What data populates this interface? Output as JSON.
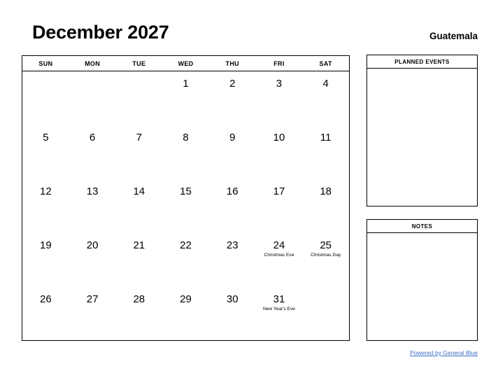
{
  "header": {
    "month_title": "December 2027",
    "country": "Guatemala"
  },
  "calendar": {
    "weekday_headers": [
      "SUN",
      "MON",
      "TUE",
      "WED",
      "THU",
      "FRI",
      "SAT"
    ],
    "weeks": [
      [
        {
          "day": "",
          "event": ""
        },
        {
          "day": "",
          "event": ""
        },
        {
          "day": "",
          "event": ""
        },
        {
          "day": "1",
          "event": ""
        },
        {
          "day": "2",
          "event": ""
        },
        {
          "day": "3",
          "event": ""
        },
        {
          "day": "4",
          "event": ""
        }
      ],
      [
        {
          "day": "5",
          "event": ""
        },
        {
          "day": "6",
          "event": ""
        },
        {
          "day": "7",
          "event": ""
        },
        {
          "day": "8",
          "event": ""
        },
        {
          "day": "9",
          "event": ""
        },
        {
          "day": "10",
          "event": ""
        },
        {
          "day": "11",
          "event": ""
        }
      ],
      [
        {
          "day": "12",
          "event": ""
        },
        {
          "day": "13",
          "event": ""
        },
        {
          "day": "14",
          "event": ""
        },
        {
          "day": "15",
          "event": ""
        },
        {
          "day": "16",
          "event": ""
        },
        {
          "day": "17",
          "event": ""
        },
        {
          "day": "18",
          "event": ""
        }
      ],
      [
        {
          "day": "19",
          "event": ""
        },
        {
          "day": "20",
          "event": ""
        },
        {
          "day": "21",
          "event": ""
        },
        {
          "day": "22",
          "event": ""
        },
        {
          "day": "23",
          "event": ""
        },
        {
          "day": "24",
          "event": "Christmas Eve"
        },
        {
          "day": "25",
          "event": "Christmas Day"
        }
      ],
      [
        {
          "day": "26",
          "event": ""
        },
        {
          "day": "27",
          "event": ""
        },
        {
          "day": "28",
          "event": ""
        },
        {
          "day": "29",
          "event": ""
        },
        {
          "day": "30",
          "event": ""
        },
        {
          "day": "31",
          "event": "New Year's Eve"
        },
        {
          "day": "",
          "event": ""
        }
      ]
    ]
  },
  "panels": {
    "planned_events_title": "PLANNED EVENTS",
    "notes_title": "NOTES"
  },
  "footer": {
    "link_text": "Powered by General Blue"
  },
  "colors": {
    "link": "#3c6fc4",
    "border": "#000000",
    "text": "#000000",
    "background": "#ffffff"
  }
}
